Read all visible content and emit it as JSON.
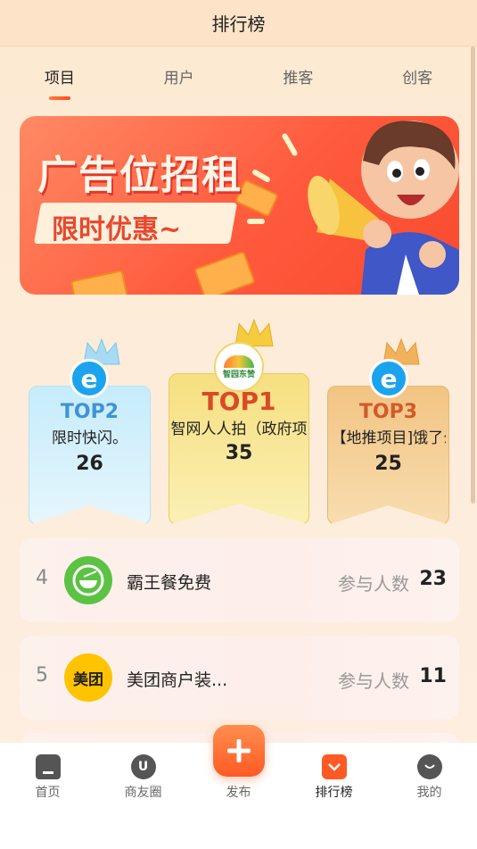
{
  "header": {
    "title": "排行榜"
  },
  "tabs": [
    {
      "label": "项目",
      "active": true
    },
    {
      "label": "用户",
      "active": false
    },
    {
      "label": "推客",
      "active": false
    },
    {
      "label": "创客",
      "active": false
    }
  ],
  "banner": {
    "headline": "广告位招租",
    "subline": "限时优惠~"
  },
  "podium": {
    "second": {
      "rank": "TOP2",
      "name": "限时快闪。",
      "count": "26"
    },
    "first": {
      "rank": "TOP1",
      "name": "智网人人拍（政府项",
      "count": "35",
      "logo_text": "智园东赞"
    },
    "third": {
      "rank": "TOP3",
      "name": "【地推项目]饿了么",
      "count": "25"
    }
  },
  "list": [
    {
      "rank": "4",
      "name": "霸王餐免费",
      "label": "参与人数",
      "count": "23",
      "logo": "bowl-icon"
    },
    {
      "rank": "5",
      "name": "美团商户装...",
      "label": "参与人数",
      "count": "11",
      "logo_text": "美团"
    }
  ],
  "nav": [
    {
      "label": "首页",
      "icon": "home-icon",
      "active": false
    },
    {
      "label": "商友圈",
      "icon": "circle-icon",
      "active": false
    },
    {
      "label": "发布",
      "icon": "plus-icon",
      "active": false
    },
    {
      "label": "排行榜",
      "icon": "ranking-icon",
      "active": true
    },
    {
      "label": "我的",
      "icon": "profile-icon",
      "active": false
    }
  ],
  "colors": {
    "accent": "#ff5a24",
    "gold": "#f6d870",
    "blue_card": "#cdeffb",
    "orange_card": "#f3c98b"
  }
}
